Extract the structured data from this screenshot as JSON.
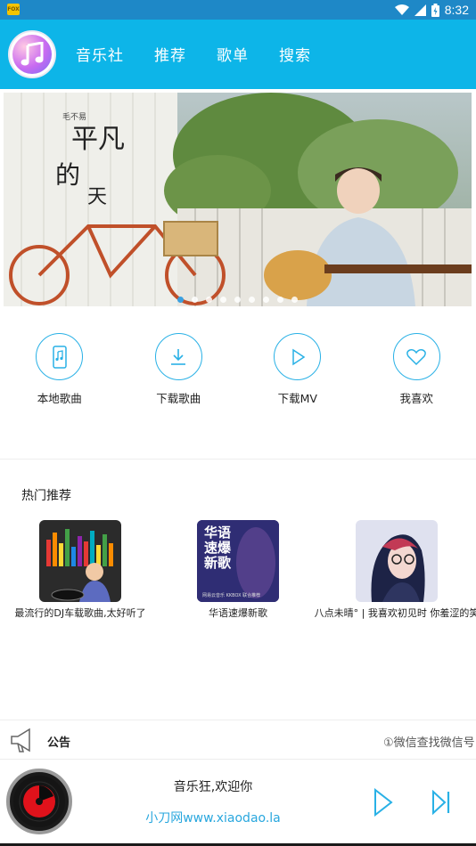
{
  "status_bar": {
    "time": "8:32",
    "app_badge": "FOX"
  },
  "header": {
    "logo": "music-note-icon",
    "tabs": [
      {
        "label": "音乐社"
      },
      {
        "label": "推荐"
      },
      {
        "label": "歌单"
      },
      {
        "label": "搜索"
      }
    ]
  },
  "banner": {
    "title_text": "平凡的天",
    "artist_tag": "毛不易",
    "slide_count": 9,
    "active_slide": 1
  },
  "quick_actions": [
    {
      "label": "本地歌曲",
      "icon": "phone-music-icon"
    },
    {
      "label": "下载歌曲",
      "icon": "download-icon"
    },
    {
      "label": "下载MV",
      "icon": "play-outline-icon"
    },
    {
      "label": "我喜欢",
      "icon": "heart-icon"
    }
  ],
  "hot": {
    "title": "热门推荐",
    "items": [
      {
        "caption": "最流行的DJ车载歌曲,太好听了"
      },
      {
        "caption": "华语速爆新歌",
        "cover_text": [
          "华语",
          "速爆",
          "新歌"
        ],
        "cover_footer": "网易云音乐 KKBOX 联合推荐"
      },
      {
        "caption": "八点未晴° | 我喜欢初见时 你羞涩的笑"
      }
    ]
  },
  "notice": {
    "title": "公告",
    "marquee": "①微信查找微信号"
  },
  "player": {
    "song": "音乐狂,欢迎你",
    "subtitle": "小刀网www.xiaodao.la"
  },
  "colors": {
    "status": "#1e88c7",
    "appbar": "#0db5e8",
    "accent": "#29b1e6"
  }
}
